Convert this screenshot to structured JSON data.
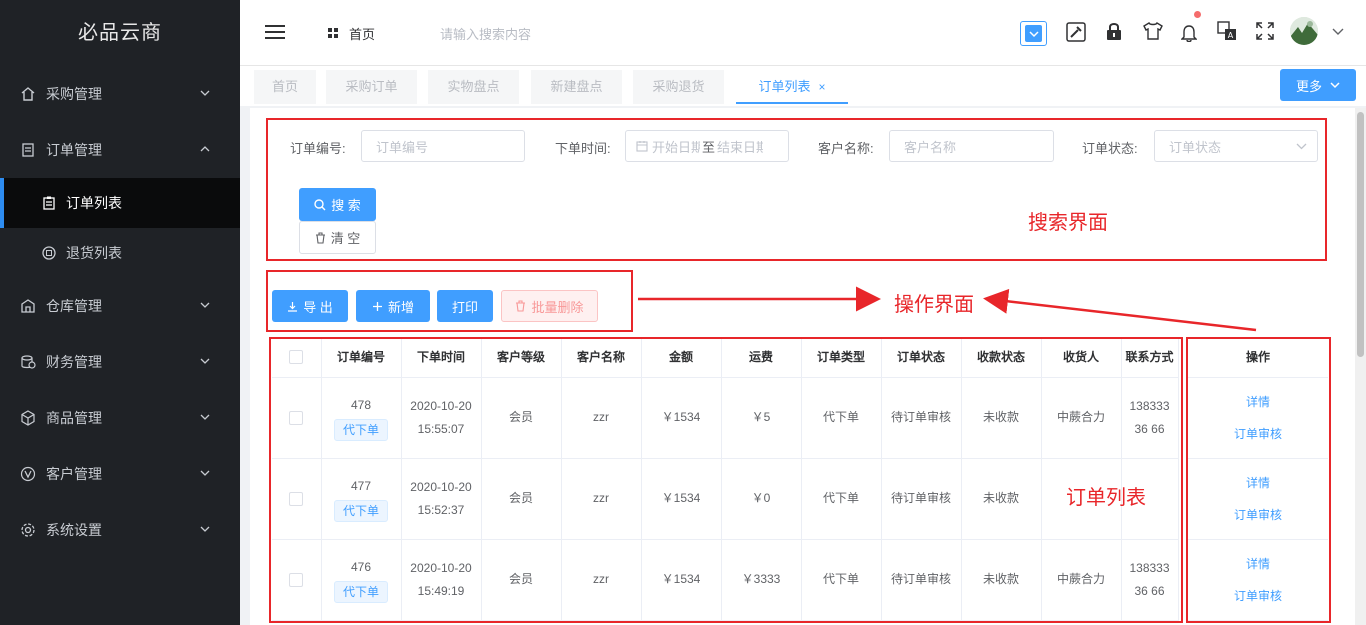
{
  "sidebar": {
    "brand": "必品云商",
    "items": [
      {
        "label": "采购管理",
        "icon": "house-icon"
      },
      {
        "label": "订单管理",
        "icon": "document-icon"
      },
      {
        "label": "仓库管理",
        "icon": "warehouse-icon"
      },
      {
        "label": "财务管理",
        "icon": "coins-icon"
      },
      {
        "label": "商品管理",
        "icon": "box-icon"
      },
      {
        "label": "客户管理",
        "icon": "customer-icon"
      },
      {
        "label": "系统设置",
        "icon": "gear-icon"
      }
    ],
    "subitems": [
      {
        "label": "订单列表",
        "icon": "clipboard-icon"
      },
      {
        "label": "退货列表",
        "icon": "return-icon"
      }
    ]
  },
  "topbar": {
    "home": "首页",
    "search_placeholder": "请输入搜索内容"
  },
  "tabs": [
    {
      "label": "首页"
    },
    {
      "label": "采购订单"
    },
    {
      "label": "实物盘点"
    },
    {
      "label": "新建盘点"
    },
    {
      "label": "采购退货"
    },
    {
      "label": "订单列表"
    }
  ],
  "tabs_more": "更多",
  "search_form": {
    "order_no_label": "订单编号:",
    "order_no_placeholder": "订单编号",
    "order_time_label": "下单时间:",
    "start_placeholder": "开始日期",
    "range_sep": "至",
    "end_placeholder": "结束日期",
    "customer_label": "客户名称:",
    "customer_placeholder": "客户名称",
    "status_label": "订单状态:",
    "status_placeholder": "订单状态",
    "search_button": "搜 索",
    "clear_button": "清 空"
  },
  "actions": {
    "export": "导 出",
    "add": "新增",
    "print": "打印",
    "batch_delete": "批量删除"
  },
  "annotations": {
    "search": "搜索界面",
    "actions": "操作界面",
    "list": "订单列表"
  },
  "table": {
    "headers": [
      "订单编号",
      "下单时间",
      "客户等级",
      "客户名称",
      "金额",
      "运费",
      "订单类型",
      "订单状态",
      "收款状态",
      "收货人",
      "联系方式"
    ],
    "ops_header": "操作",
    "rows": [
      {
        "id": "478",
        "tag": "代下单",
        "time": "2020-10-20 15:55:07",
        "level": "会员",
        "customer": "zzr",
        "amount": "￥1534",
        "freight": "￥5",
        "type": "代下单",
        "status": "待订单审核",
        "pay_status": "未收款",
        "receiver": "中蕨合力",
        "contact": "13833336 66"
      },
      {
        "id": "477",
        "tag": "代下单",
        "time": "2020-10-20 15:52:37",
        "level": "会员",
        "customer": "zzr",
        "amount": "￥1534",
        "freight": "￥0",
        "type": "代下单",
        "status": "待订单审核",
        "pay_status": "未收款",
        "receiver": "",
        "contact": ""
      },
      {
        "id": "476",
        "tag": "代下单",
        "time": "2020-10-20 15:49:19",
        "level": "会员",
        "customer": "zzr",
        "amount": "￥1534",
        "freight": "￥3333",
        "type": "代下单",
        "status": "待订单审核",
        "pay_status": "未收款",
        "receiver": "中蕨合力",
        "contact": "13833336 66"
      }
    ],
    "ops": {
      "detail": "详情",
      "audit": "订单审核"
    }
  },
  "colors": {
    "primary": "#409eff",
    "annotation": "#e8262a",
    "sidebar_bg": "#1f2226"
  }
}
